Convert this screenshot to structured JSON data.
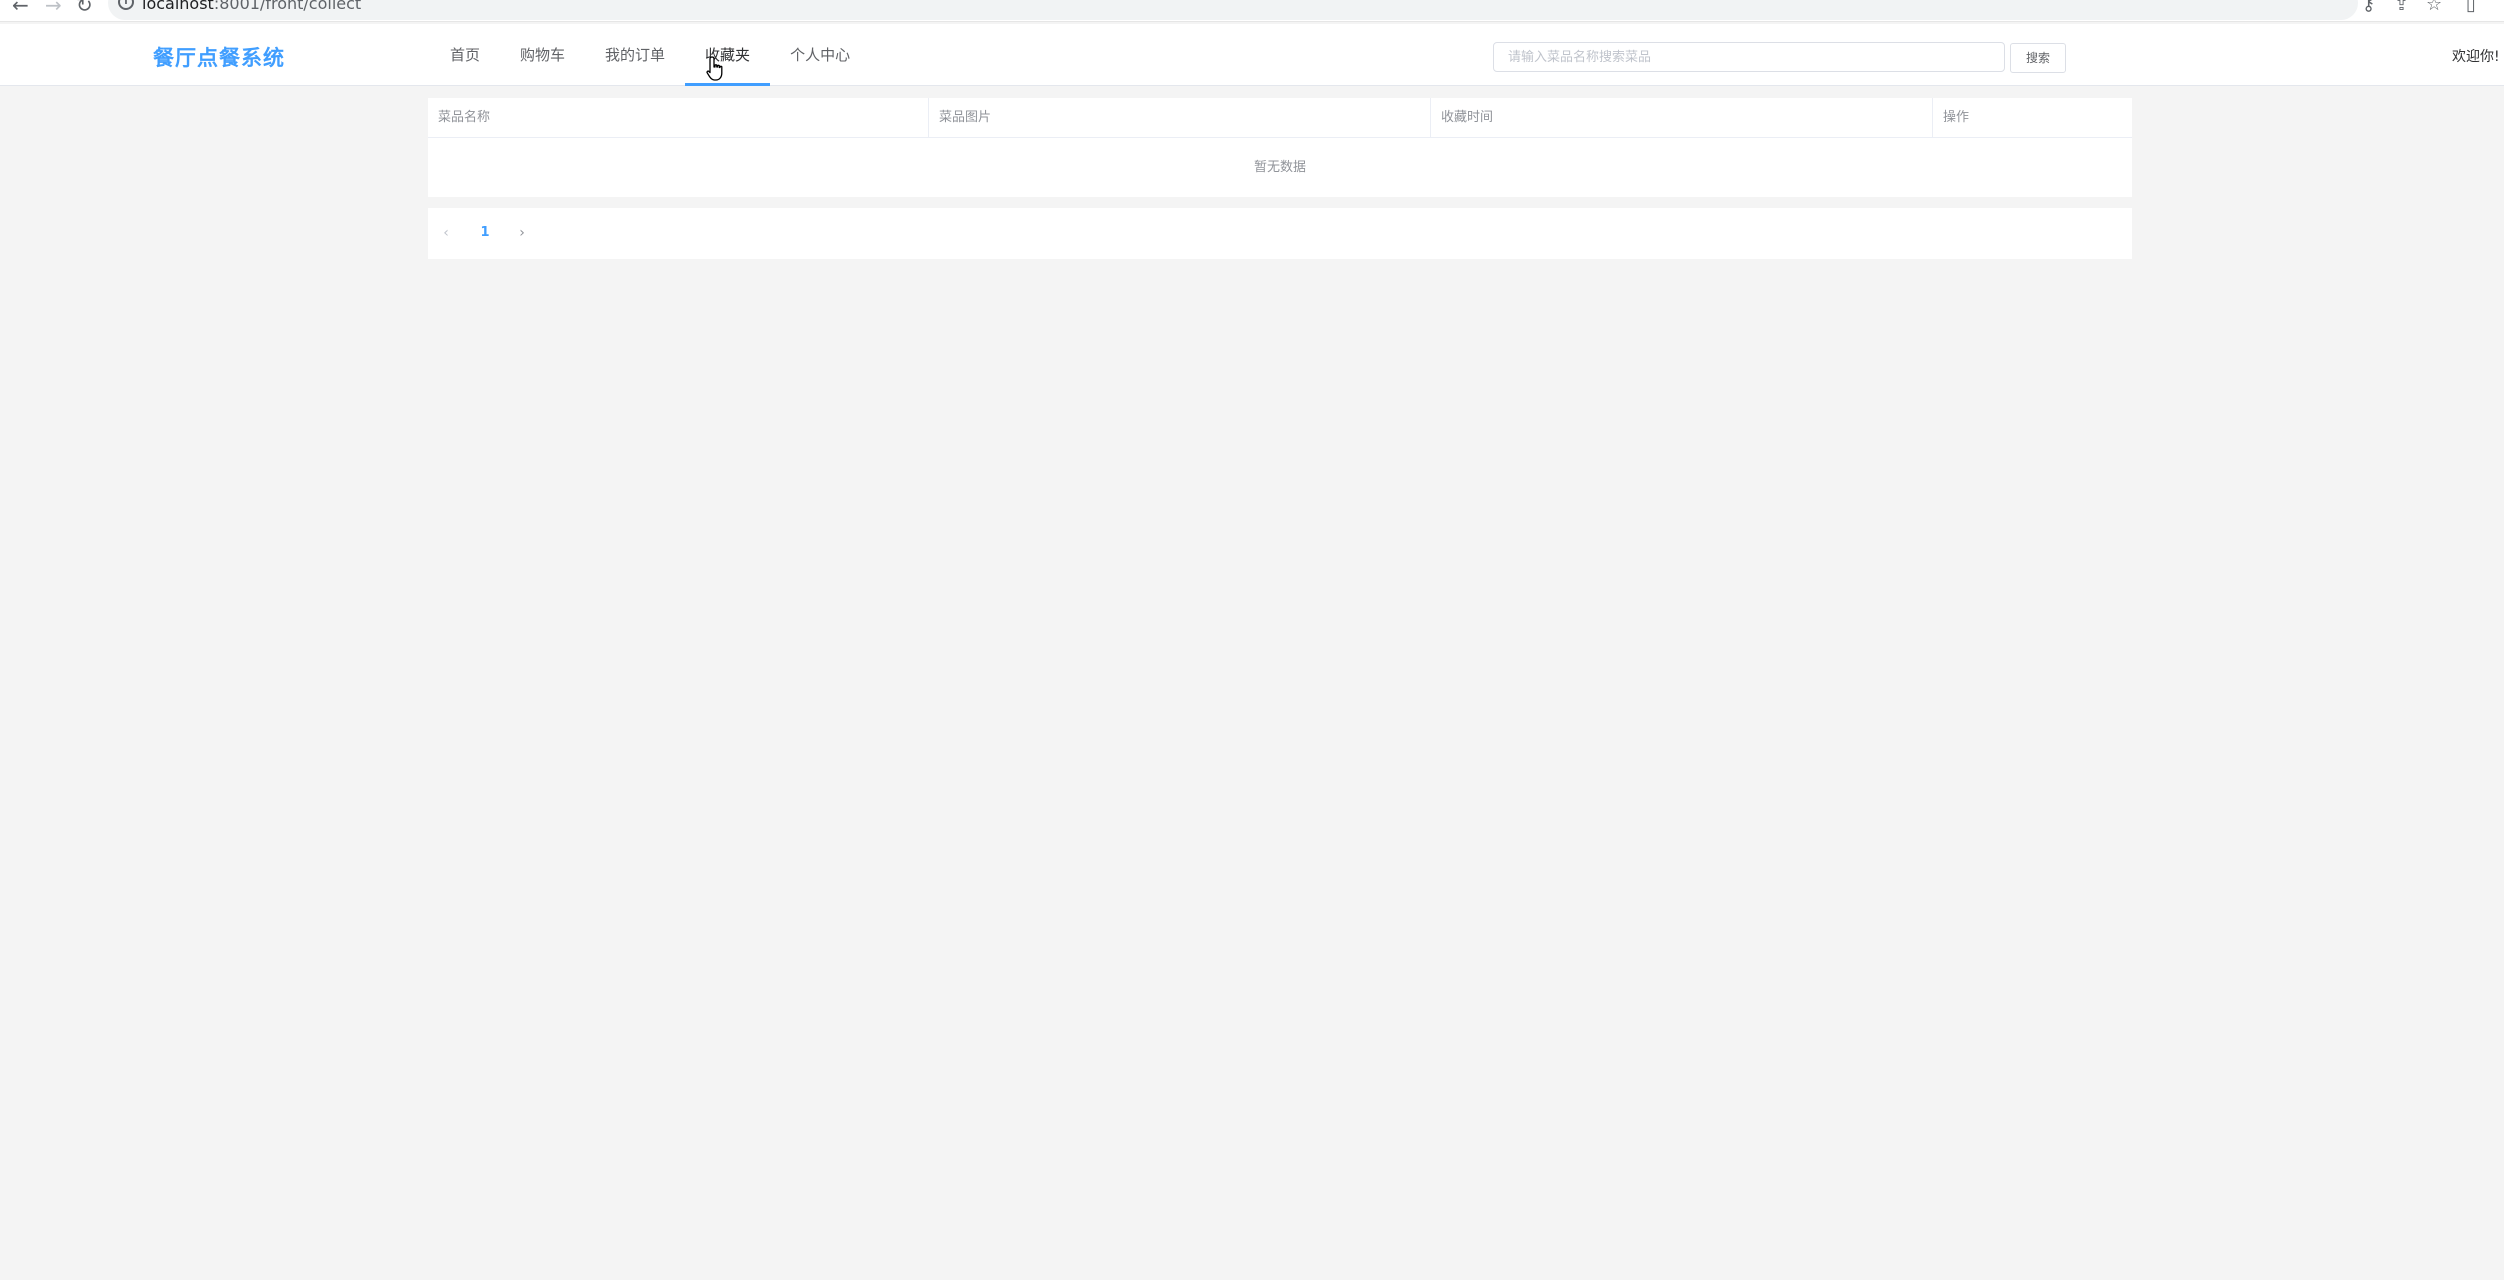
{
  "browser": {
    "back_glyph": "←",
    "forward_glyph": "→",
    "reload_glyph": "↻",
    "info_glyph": "i",
    "url_host": "localhost",
    "url_path": ":8001/front/collect",
    "icons": [
      "key-icon",
      "share-icon",
      "star-icon",
      "sidepanel-icon"
    ],
    "key_glyph": "⚷",
    "share_glyph": "⇪",
    "star_glyph": "☆",
    "panel_glyph": "▯"
  },
  "header": {
    "logo": "餐厅点餐系统",
    "menu": [
      {
        "label": "首页",
        "active": false
      },
      {
        "label": "购物车",
        "active": false
      },
      {
        "label": "我的订单",
        "active": false
      },
      {
        "label": "收藏夹",
        "active": true
      },
      {
        "label": "个人中心",
        "active": false
      }
    ],
    "search_placeholder": "请输入菜品名称搜索菜品",
    "search_value": "",
    "search_button": "搜索",
    "welcome": "欢迎你!"
  },
  "table": {
    "columns": [
      "菜品名称",
      "菜品图片",
      "收藏时间",
      "操作"
    ],
    "rows": [],
    "empty_text": "暂无数据"
  },
  "pagination": {
    "prev_glyph": "‹",
    "next_glyph": "›",
    "current_page": "1"
  },
  "colors": {
    "accent": "#409eff",
    "background": "#f4f4f4",
    "text_muted": "#909399"
  }
}
